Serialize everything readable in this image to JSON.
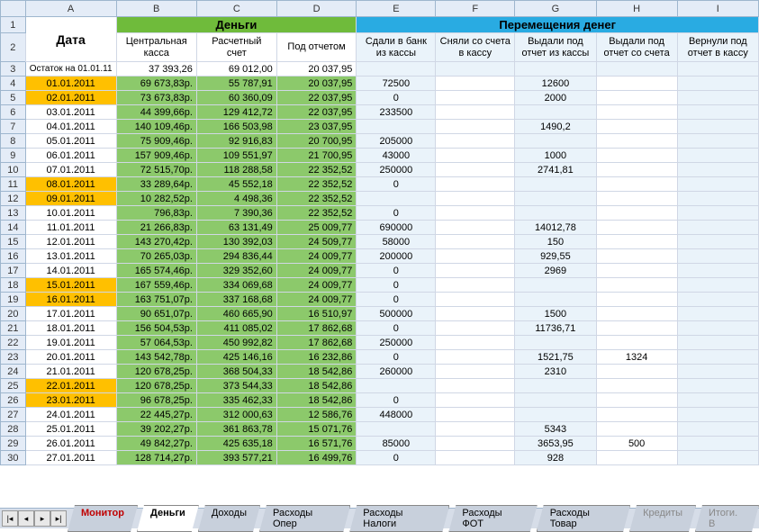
{
  "columns": [
    "A",
    "B",
    "C",
    "D",
    "E",
    "F",
    "G",
    "H",
    "I"
  ],
  "headers": {
    "money": "Деньги",
    "movements": "Перемещения денег",
    "date": "Дата",
    "sub": [
      "Центральная касса",
      "Расчетный счет",
      "Под отчетом",
      "Сдали в банк из кассы",
      "Сняли со счета в кассу",
      "Выдали под отчет из кассы",
      "Выдали под отчет со счета",
      "Вернули под отчет в кассу"
    ]
  },
  "remain_label": "Остаток на 01.01.11",
  "remain": [
    "37 393,26",
    "69 012,00",
    "20 037,95"
  ],
  "rows": [
    {
      "n": 4,
      "d": "01.01.2011",
      "o": true,
      "m": [
        "69 673,83р.",
        "55 787,91",
        "20 037,95"
      ],
      "v": [
        "72500",
        "",
        "12600",
        "",
        ""
      ]
    },
    {
      "n": 5,
      "d": "02.01.2011",
      "o": true,
      "m": [
        "73 673,83р.",
        "60 360,09",
        "22 037,95"
      ],
      "v": [
        "0",
        "",
        "2000",
        "",
        ""
      ]
    },
    {
      "n": 6,
      "d": "03.01.2011",
      "o": false,
      "m": [
        "44 399,66р.",
        "129 412,72",
        "22 037,95"
      ],
      "v": [
        "233500",
        "",
        "",
        "",
        ""
      ]
    },
    {
      "n": 7,
      "d": "04.01.2011",
      "o": false,
      "m": [
        "140 109,46р.",
        "166 503,98",
        "23 037,95"
      ],
      "v": [
        "",
        "",
        "1490,2",
        "",
        ""
      ]
    },
    {
      "n": 8,
      "d": "05.01.2011",
      "o": false,
      "m": [
        "75 909,46р.",
        "92 916,83",
        "20 700,95"
      ],
      "v": [
        "205000",
        "",
        "",
        "",
        ""
      ]
    },
    {
      "n": 9,
      "d": "06.01.2011",
      "o": false,
      "m": [
        "157 909,46р.",
        "109 551,97",
        "21 700,95"
      ],
      "v": [
        "43000",
        "",
        "1000",
        "",
        ""
      ]
    },
    {
      "n": 10,
      "d": "07.01.2011",
      "o": false,
      "m": [
        "72 515,70р.",
        "118 288,58",
        "22 352,52"
      ],
      "v": [
        "250000",
        "",
        "2741,81",
        "",
        ""
      ]
    },
    {
      "n": 11,
      "d": "08.01.2011",
      "o": true,
      "m": [
        "33 289,64р.",
        "45 552,18",
        "22 352,52"
      ],
      "v": [
        "0",
        "",
        "",
        "",
        ""
      ]
    },
    {
      "n": 12,
      "d": "09.01.2011",
      "o": true,
      "m": [
        "10 282,52р.",
        "4 498,36",
        "22 352,52"
      ],
      "v": [
        "",
        "",
        "",
        "",
        ""
      ]
    },
    {
      "n": 13,
      "d": "10.01.2011",
      "o": false,
      "m": [
        "796,83р.",
        "7 390,36",
        "22 352,52"
      ],
      "v": [
        "0",
        "",
        "",
        "",
        ""
      ]
    },
    {
      "n": 14,
      "d": "11.01.2011",
      "o": false,
      "m": [
        "21 266,83р.",
        "63 131,49",
        "25 009,77"
      ],
      "v": [
        "690000",
        "",
        "14012,78",
        "",
        ""
      ]
    },
    {
      "n": 15,
      "d": "12.01.2011",
      "o": false,
      "m": [
        "143 270,42р.",
        "130 392,03",
        "24 509,77"
      ],
      "v": [
        "58000",
        "",
        "150",
        "",
        ""
      ]
    },
    {
      "n": 16,
      "d": "13.01.2011",
      "o": false,
      "m": [
        "70 265,03р.",
        "294 836,44",
        "24 009,77"
      ],
      "v": [
        "200000",
        "",
        "929,55",
        "",
        ""
      ]
    },
    {
      "n": 17,
      "d": "14.01.2011",
      "o": false,
      "m": [
        "165 574,46р.",
        "329 352,60",
        "24 009,77"
      ],
      "v": [
        "0",
        "",
        "2969",
        "",
        ""
      ]
    },
    {
      "n": 18,
      "d": "15.01.2011",
      "o": true,
      "m": [
        "167 559,46р.",
        "334 069,68",
        "24 009,77"
      ],
      "v": [
        "0",
        "",
        "",
        "",
        ""
      ]
    },
    {
      "n": 19,
      "d": "16.01.2011",
      "o": true,
      "m": [
        "163 751,07р.",
        "337 168,68",
        "24 009,77"
      ],
      "v": [
        "0",
        "",
        "",
        "",
        ""
      ]
    },
    {
      "n": 20,
      "d": "17.01.2011",
      "o": false,
      "m": [
        "90 651,07р.",
        "460 665,90",
        "16 510,97"
      ],
      "v": [
        "500000",
        "",
        "1500",
        "",
        ""
      ]
    },
    {
      "n": 21,
      "d": "18.01.2011",
      "o": false,
      "m": [
        "156 504,53р.",
        "411 085,02",
        "17 862,68"
      ],
      "v": [
        "0",
        "",
        "11736,71",
        "",
        ""
      ]
    },
    {
      "n": 22,
      "d": "19.01.2011",
      "o": false,
      "m": [
        "57 064,53р.",
        "450 992,82",
        "17 862,68"
      ],
      "v": [
        "250000",
        "",
        "",
        "",
        ""
      ]
    },
    {
      "n": 23,
      "d": "20.01.2011",
      "o": false,
      "m": [
        "143 542,78р.",
        "425 146,16",
        "16 232,86"
      ],
      "v": [
        "0",
        "",
        "1521,75",
        "1324",
        ""
      ]
    },
    {
      "n": 24,
      "d": "21.01.2011",
      "o": false,
      "m": [
        "120 678,25р.",
        "368 504,33",
        "18 542,86"
      ],
      "v": [
        "260000",
        "",
        "2310",
        "",
        ""
      ]
    },
    {
      "n": 25,
      "d": "22.01.2011",
      "o": true,
      "m": [
        "120 678,25р.",
        "373 544,33",
        "18 542,86"
      ],
      "v": [
        "",
        "",
        "",
        "",
        ""
      ]
    },
    {
      "n": 26,
      "d": "23.01.2011",
      "o": true,
      "m": [
        "96 678,25р.",
        "335 462,33",
        "18 542,86"
      ],
      "v": [
        "0",
        "",
        "",
        "",
        ""
      ]
    },
    {
      "n": 27,
      "d": "24.01.2011",
      "o": false,
      "m": [
        "22 445,27р.",
        "312 000,63",
        "12 586,76"
      ],
      "v": [
        "448000",
        "",
        "",
        "",
        ""
      ]
    },
    {
      "n": 28,
      "d": "25.01.2011",
      "o": false,
      "m": [
        "39 202,27р.",
        "361 863,78",
        "15 071,76"
      ],
      "v": [
        "",
        "",
        "5343",
        "",
        ""
      ]
    },
    {
      "n": 29,
      "d": "26.01.2011",
      "o": false,
      "m": [
        "49 842,27р.",
        "425 635,18",
        "16 571,76"
      ],
      "v": [
        "85000",
        "",
        "3653,95",
        "500",
        ""
      ]
    },
    {
      "n": 30,
      "d": "27.01.2011",
      "o": false,
      "m": [
        "128 714,27р.",
        "393 577,21",
        "16 499,76"
      ],
      "v": [
        "0",
        "",
        "928",
        "",
        ""
      ]
    }
  ],
  "tabs": {
    "items": [
      "Монитор",
      "Деньги",
      "Доходы",
      "Расходы Опер",
      "Расходы Налоги",
      "Расходы ФОТ",
      "Расходы Товар",
      "Кредиты",
      "Итоги. В"
    ],
    "active": 1,
    "red": [
      0
    ],
    "gray": [
      7,
      8
    ]
  },
  "chart_data": {
    "type": "table",
    "title": "Деньги / Перемещения денег",
    "columns": [
      "Дата",
      "Центральная касса",
      "Расчетный счет",
      "Под отчетом",
      "Сдали в банк из кассы",
      "Сняли со счета в кассу",
      "Выдали под отчет из кассы",
      "Выдали под отчет со счета",
      "Вернули под отчет в кассу"
    ]
  }
}
